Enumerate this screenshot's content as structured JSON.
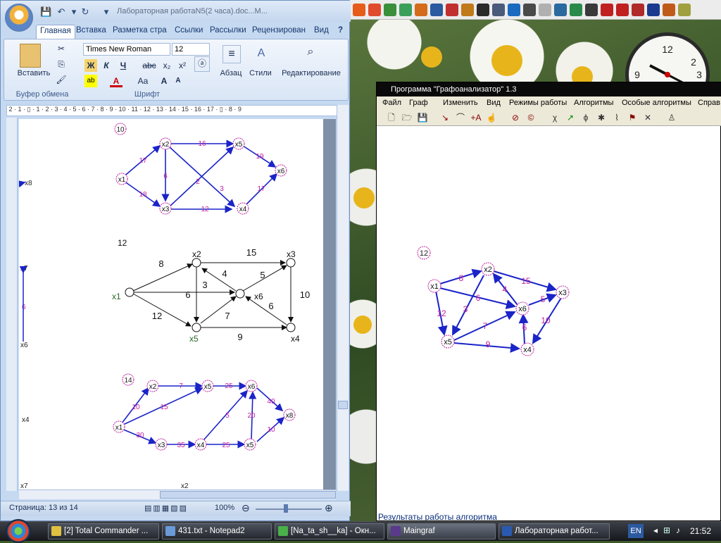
{
  "word": {
    "doc_title": "Лабораторная работаN5(2 часа).doc...M...",
    "tabs": [
      "Главная",
      "Вставка",
      "Разметка стра",
      "Ссылки",
      "Рассылки",
      "Рецензирован",
      "Вид"
    ],
    "paste_label": "Вставить",
    "clipboard_group": "Буфер обмена",
    "font_name": "Times New Roman",
    "font_size": "12",
    "font_group": "Шрифт",
    "paragraph_label": "Абзац",
    "styles_label": "Стили",
    "editing_label": "Редактирование",
    "status_page": "Страница: 13 из 14",
    "zoom": "100%",
    "graph10": {
      "number": "10",
      "nodes": [
        "x1",
        "x2",
        "x3",
        "x4",
        "x5",
        "x6"
      ],
      "weights": [
        "17",
        "18",
        "6",
        "16",
        "2",
        "3",
        "12",
        "19",
        "17"
      ]
    },
    "graph12": {
      "number": "12",
      "nodes": [
        "x1",
        "x2",
        "x3",
        "x4",
        "x5",
        "x6"
      ],
      "weights": [
        "8",
        "15",
        "4",
        "5",
        "3",
        "6",
        "10",
        "6",
        "7",
        "12",
        "9"
      ]
    },
    "graph14": {
      "number": "14",
      "nodes": [
        "x1",
        "x2",
        "x3",
        "x4",
        "x5",
        "x6",
        "x5",
        "x8"
      ],
      "weights": [
        "10",
        "15",
        "7",
        "25",
        "40",
        "30",
        "35",
        "25",
        "5",
        "20",
        "10"
      ]
    },
    "left_edge_labels": [
      "x8",
      "x7",
      "6",
      "x6",
      "x4",
      "x7",
      "x2"
    ]
  },
  "grafoanalyzer": {
    "title": "Программа \"Графоанализатор\" 1.3",
    "menu": [
      "Файл",
      "Граф",
      "Изменить",
      "Вид",
      "Режимы работы",
      "Алгоритмы",
      "Особые алгоритмы",
      "Справ"
    ],
    "results_label": "Результаты работы алгоритма",
    "graph": {
      "number": "12",
      "nodes": [
        "x1",
        "x2",
        "x3",
        "x4",
        "x5",
        "x6"
      ],
      "weights": [
        "8",
        "15",
        "4",
        "6",
        "5",
        "3",
        "12",
        "7",
        "6",
        "10",
        "9"
      ]
    }
  },
  "clock": {
    "marks": [
      "12",
      "2",
      "3",
      "9"
    ]
  },
  "taskbar": {
    "items": [
      "[2] Total Commander ...",
      "431.txt - Notepad2",
      "[Na_ta_sh__ka] - Окн...",
      "Maingraf",
      "Лабораторная работ..."
    ],
    "lang": "EN",
    "time": "21:52"
  }
}
